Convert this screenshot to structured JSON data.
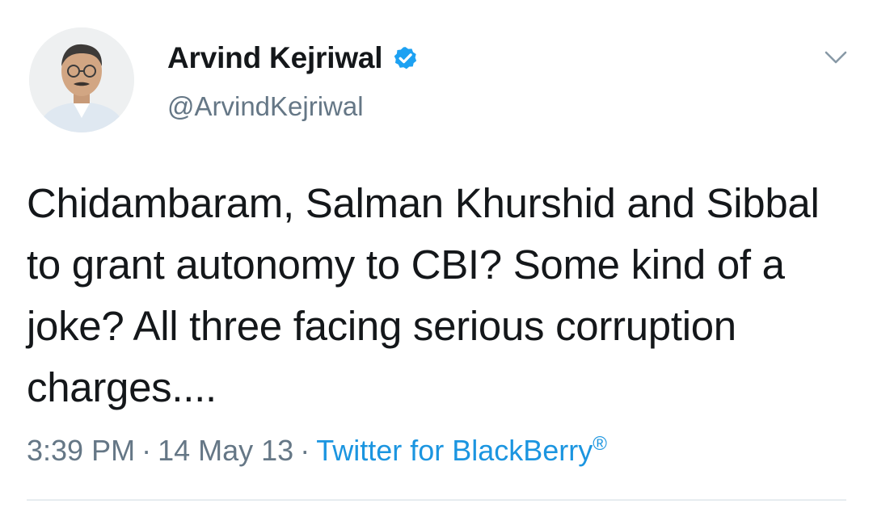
{
  "author": {
    "display_name": "Arvind Kejriwal",
    "handle": "@ArvindKejriwal",
    "verified": true,
    "verified_icon": "verified-badge-icon"
  },
  "tweet": {
    "text": "Chidambaram, Salman Khurshid and Sibbal to grant autonomy to CBI? Some kind of a joke? All three facing serious corruption charges...."
  },
  "meta": {
    "time": "3:39 PM",
    "separator": "·",
    "date": "14 May 13",
    "source": "Twitter for BlackBerry",
    "source_mark": "®"
  },
  "menu": {
    "icon": "chevron-down-icon"
  },
  "colors": {
    "text": "#14171a",
    "secondary": "#657786",
    "link": "#1b95e0",
    "verified": "#1da1f2",
    "divider": "#e6ecf0"
  }
}
